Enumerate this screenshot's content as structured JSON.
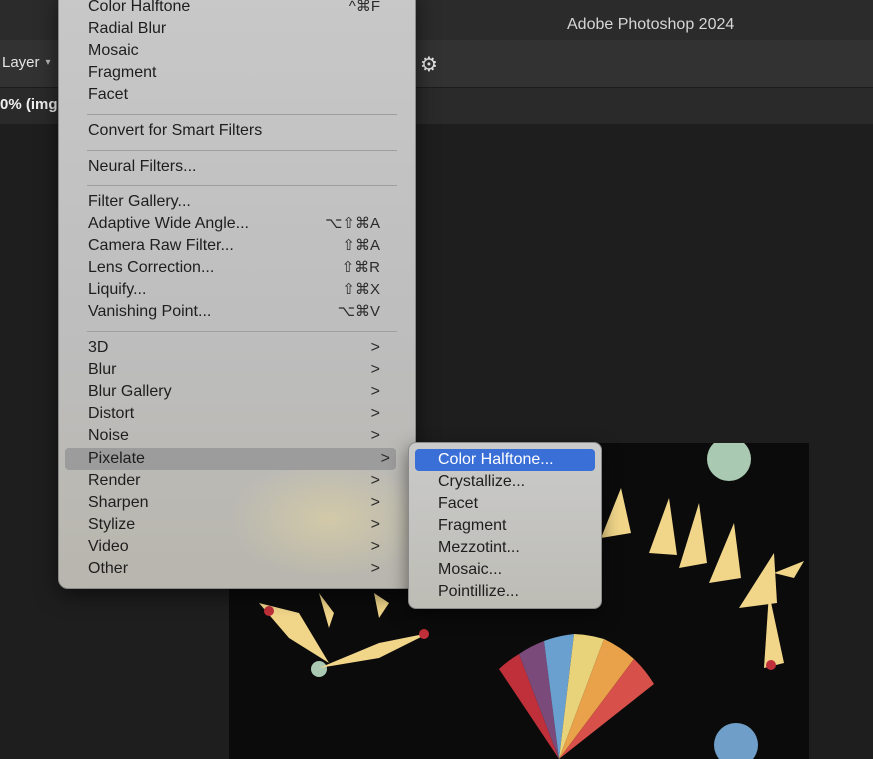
{
  "app": {
    "title": "Adobe Photoshop 2024"
  },
  "options_bar": {
    "layer_select": "Layer"
  },
  "document_tab": {
    "label": "0% (img"
  },
  "filter_menu": {
    "group1": [
      {
        "label": "Color Halftone",
        "shortcut": "^⌘F"
      },
      {
        "label": "Radial Blur"
      },
      {
        "label": "Mosaic"
      },
      {
        "label": "Fragment"
      },
      {
        "label": "Facet"
      }
    ],
    "group2": [
      {
        "label": "Convert for Smart Filters"
      }
    ],
    "group3": [
      {
        "label": "Neural Filters..."
      }
    ],
    "group4": [
      {
        "label": "Filter Gallery..."
      },
      {
        "label": "Adaptive Wide Angle...",
        "shortcut": "⌥⇧⌘A"
      },
      {
        "label": "Camera Raw Filter...",
        "shortcut": "⇧⌘A"
      },
      {
        "label": "Lens Correction...",
        "shortcut": "⇧⌘R"
      },
      {
        "label": "Liquify...",
        "shortcut": "⇧⌘X"
      },
      {
        "label": "Vanishing Point...",
        "shortcut": "⌥⌘V"
      }
    ],
    "group5": [
      {
        "label": "3D"
      },
      {
        "label": "Blur"
      },
      {
        "label": "Blur Gallery"
      },
      {
        "label": "Distort"
      },
      {
        "label": "Noise"
      },
      {
        "label": "Pixelate",
        "active": true
      },
      {
        "label": "Render"
      },
      {
        "label": "Sharpen"
      },
      {
        "label": "Stylize"
      },
      {
        "label": "Video"
      },
      {
        "label": "Other"
      }
    ],
    "submenu_arrow": ">"
  },
  "pixelate_submenu": {
    "items": [
      {
        "label": "Color Halftone...",
        "highlighted": true
      },
      {
        "label": "Crystallize..."
      },
      {
        "label": "Facet"
      },
      {
        "label": "Fragment"
      },
      {
        "label": "Mezzotint..."
      },
      {
        "label": "Mosaic..."
      },
      {
        "label": "Pointillize..."
      }
    ]
  },
  "colors": {
    "highlight": "#3a6fd8",
    "menu_bg": "#c4c4c4",
    "app_bg": "#1e1e1e"
  }
}
